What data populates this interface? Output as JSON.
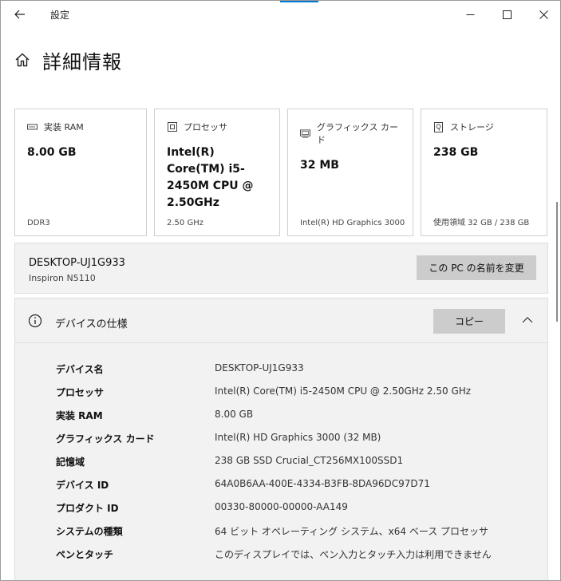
{
  "window": {
    "title": "設定"
  },
  "page": {
    "title": "詳細情報"
  },
  "cards": [
    {
      "icon": "ram-icon",
      "label": "実装 RAM",
      "value": "8.00 GB",
      "footer": "DDR3"
    },
    {
      "icon": "processor-icon",
      "label": "プロセッサ",
      "value": "Intel(R) Core(TM) i5-2450M CPU @ 2.50GHz",
      "footer": "2.50 GHz"
    },
    {
      "icon": "graphics-card-icon",
      "label": "グラフィックス カード",
      "value": "32 MB",
      "footer": "Intel(R) HD Graphics 3000"
    },
    {
      "icon": "storage-icon",
      "label": "ストレージ",
      "value": "238 GB",
      "footer": "使用領域 32 GB / 238 GB"
    }
  ],
  "pc": {
    "name": "DESKTOP-UJ1G933",
    "model": "Inspiron N5110",
    "rename_label": "この PC の名前を変更"
  },
  "device_specs": {
    "title": "デバイスの仕様",
    "copy_label": "コピー",
    "rows": [
      {
        "label": "デバイス名",
        "value": "DESKTOP-UJ1G933"
      },
      {
        "label": "プロセッサ",
        "value": "Intel(R) Core(TM) i5-2450M CPU @ 2.50GHz   2.50 GHz"
      },
      {
        "label": "実装 RAM",
        "value": "8.00 GB"
      },
      {
        "label": "グラフィックス カード",
        "value": "Intel(R) HD Graphics 3000 (32 MB)"
      },
      {
        "label": "記憶域",
        "value": "238 GB SSD Crucial_CT256MX100SSD1"
      },
      {
        "label": "デバイス ID",
        "value": "64A0B6AA-400E-4334-B3FB-8DA96DC97D71"
      },
      {
        "label": "プロダクト ID",
        "value": "00330-80000-00000-AA149"
      },
      {
        "label": "システムの種類",
        "value": "64 ビット オペレーティング システム、x64 ベース プロセッサ"
      },
      {
        "label": "ペンとタッチ",
        "value": "このディスプレイでは、ペン入力とタッチ入力は利用できません"
      }
    ]
  },
  "colors": {
    "accent": "#0078d4",
    "card_border": "#cfcfcf",
    "panel_bg": "#f2f2f2",
    "button_bg": "#cccccc"
  }
}
